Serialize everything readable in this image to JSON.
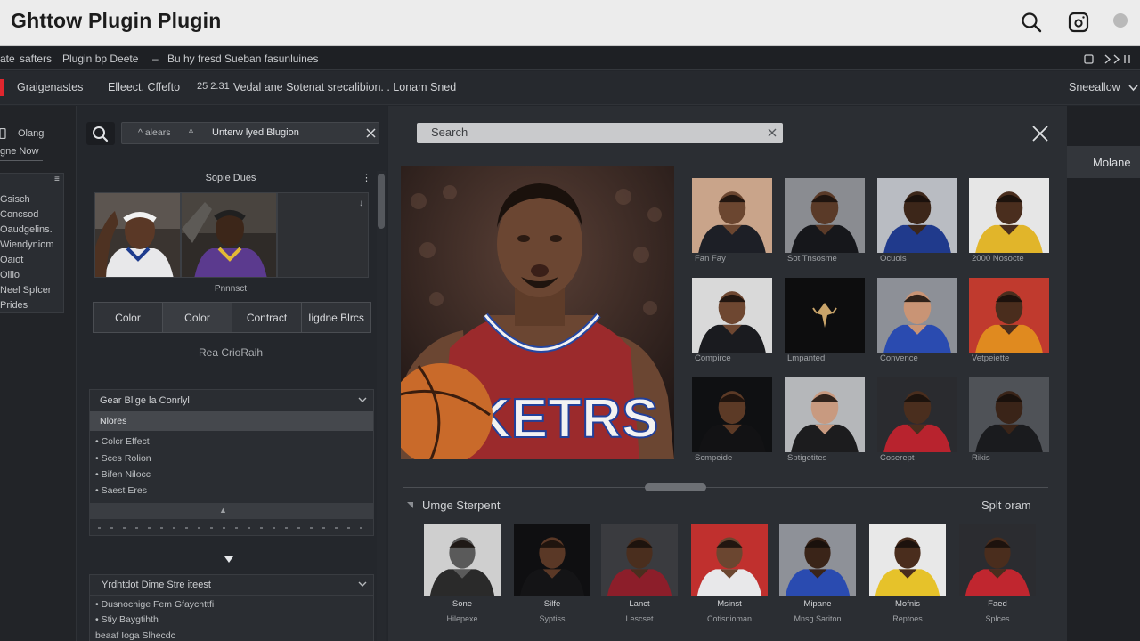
{
  "app": {
    "title": "Ghttow Plugin Plugin"
  },
  "titlebar_icons": [
    "search-icon",
    "instagram-icon",
    "circle-icon"
  ],
  "menu": {
    "left_text": "ate",
    "items": [
      "safters",
      "Plugin bp Deete",
      "–",
      "Bu hy fresd Sueban fasunluines"
    ],
    "right_icons": [
      "square-icon",
      "chevrons-right-icon"
    ]
  },
  "toolbar": {
    "brand": "Graigenastes",
    "filter": "Elleect. Cffefto",
    "count": "25 2.31",
    "description": "Vedal ane Sotenat srecalibion. . Lonam Sned",
    "dropdown": "Sneeallow"
  },
  "leftnav": {
    "top_items": [
      "Olang",
      "gne Now"
    ],
    "list_items": [
      "Gsisch",
      "Concsod",
      "Oaudgelins.",
      "Wiendyniom",
      "Oaiot",
      "Oiiio",
      "Neel Spfcer",
      "Prides"
    ]
  },
  "plugin_panel": {
    "field_prefix": "^ alears",
    "field_value": "Unterw lyed Blugion",
    "preview_title": "Sopie Dues",
    "preview_caption": "Pnnnsct",
    "adjust_buttons": [
      "Color",
      "Color",
      "Contract",
      "Iigdne Blrcs"
    ],
    "reset_link": "Rea CrioRaih",
    "section1": {
      "title": "Gear Blige la Conrlyl",
      "subheader": "Nlores",
      "bullets": [
        "• Colcr Effect",
        "• Sces Rolion",
        "• Bifen Nilocc",
        "• Saest Eres"
      ]
    },
    "section2": {
      "title": "Yrdhtdot Dime Stre iteest",
      "bullets": [
        "• Dusnochige Fem Gfaychttfi",
        "• Stiy Baygtihth",
        "beaaf Ioga Slhecdc"
      ]
    }
  },
  "main": {
    "search_placeholder": "Search",
    "hero_jersey": "OKETRS",
    "grid": [
      {
        "label": "Fan Fay",
        "skin": "#6b4630",
        "jersey": "#1d1f26",
        "bg": "#c9a48a"
      },
      {
        "label": "Sot Tnsosme",
        "skin": "#5a3a28",
        "jersey": "#16171b",
        "bg": "#8a8c91"
      },
      {
        "label": "Ocuois",
        "skin": "#3c2619",
        "jersey": "#203a8c",
        "bg": "#b9bcc2"
      },
      {
        "label": "2000 Nosocte",
        "skin": "#4a2e1e",
        "jersey": "#e1b52a",
        "bg": "#e6e6e6"
      },
      {
        "label": "Compirce",
        "skin": "#6e4731",
        "jersey": "#1a1b1f",
        "bg": "#d9d9d9"
      },
      {
        "label": "Lmpanted",
        "skin": "#000000",
        "jersey": "#000000",
        "bg": "#0d0d0e"
      },
      {
        "label": "Convence",
        "skin": "#c99475",
        "jersey": "#2a4bb0",
        "bg": "#8d9097"
      },
      {
        "label": "Vetpeiette",
        "skin": "#4a2d1d",
        "jersey": "#e08a1f",
        "bg": "#c03a2e"
      },
      {
        "label": "Scmpeide",
        "skin": "#5c3a26",
        "jersey": "#121214",
        "bg": "#0f1012"
      },
      {
        "label": "Sptigetites",
        "skin": "#c89a80",
        "jersey": "#1c1c1e",
        "bg": "#b5b7ba"
      },
      {
        "label": "Coserept",
        "skin": "#4a2e1e",
        "jersey": "#b8232e",
        "bg": "#2a2b2f"
      },
      {
        "label": "Rikis",
        "skin": "#3a2418",
        "jersey": "#1a1b1e",
        "bg": "#4f5257"
      }
    ],
    "image_strip_title": "Umge Sterpent",
    "split_label": "Splt oram",
    "strip": [
      {
        "name": "Sone",
        "sub": "Hilepexe",
        "skin": "#5a5a5a",
        "jersey": "#2a2a2a",
        "bg": "#cfcfcf"
      },
      {
        "name": "Silfe",
        "sub": "Syptiss",
        "skin": "#5a3826",
        "jersey": "#141416",
        "bg": "#0f0f11"
      },
      {
        "name": "Lanct",
        "sub": "Lescset",
        "skin": "#4a2e1e",
        "jersey": "#8c1e2a",
        "bg": "#3a3b3f"
      },
      {
        "name": "Msinst",
        "sub": "Cotisnioman",
        "skin": "#6b4630",
        "jersey": "#e8e8ea",
        "bg": "#c0302e"
      },
      {
        "name": "Mipane",
        "sub": "Mnsg Sariton",
        "skin": "#3a2418",
        "jersey": "#2a4bb0",
        "bg": "#8e9198"
      },
      {
        "name": "Mofnis",
        "sub": "Reptoes",
        "skin": "#4a2d1d",
        "jersey": "#e6c22a",
        "bg": "#e8e8e8"
      },
      {
        "name": "Faed",
        "sub": "Splces",
        "skin": "#4a2d1d",
        "jersey": "#c0262f",
        "bg": "#2b2c30"
      }
    ]
  },
  "right_panel": {
    "tab": "Molane"
  },
  "colors": {
    "titlebar_bg": "#ececec",
    "panel_bg": "#24272c",
    "main_bg": "#2b2e33",
    "search_bg": "#c9cacc",
    "accent_red": "#e0262e"
  }
}
